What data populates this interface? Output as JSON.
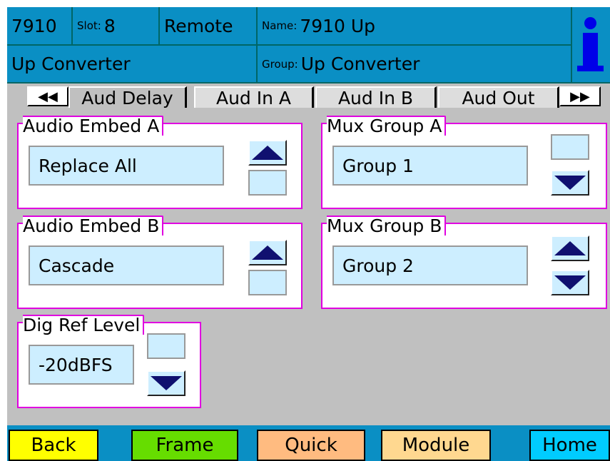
{
  "header": {
    "model": "7910",
    "slot_label": "Slot:",
    "slot_value": "8",
    "mode": "Remote",
    "name_label": "Name:",
    "name_value": "7910 Up",
    "module_type": "Up Converter",
    "group_label": "Group:",
    "group_value": "Up Converter",
    "info_icon": "info-icon"
  },
  "tabs": {
    "prev_icon": "double-left-arrow-icon",
    "next_icon": "double-right-arrow-icon",
    "items": [
      {
        "label": "Aud Delay"
      },
      {
        "label": "Aud In A"
      },
      {
        "label": "Aud In B"
      },
      {
        "label": "Aud Out"
      }
    ]
  },
  "controls": {
    "audio_embed_a": {
      "label": "Audio Embed A",
      "value": "Replace All"
    },
    "mux_group_a": {
      "label": "Mux Group A",
      "value": "Group 1"
    },
    "audio_embed_b": {
      "label": "Audio Embed B",
      "value": "Cascade"
    },
    "mux_group_b": {
      "label": "Mux Group B",
      "value": "Group 2"
    },
    "dig_ref_level": {
      "label": "Dig Ref Level",
      "value": "-20dBFS"
    }
  },
  "footer": {
    "back": {
      "label": "Back",
      "color": "#ffff00"
    },
    "frame": {
      "label": "Frame",
      "color": "#66dd00"
    },
    "quick": {
      "label": "Quick",
      "color": "#ffbb80"
    },
    "module": {
      "label": "Module",
      "color": "#ffd890"
    },
    "home": {
      "label": "Home",
      "color": "#00ccff"
    }
  },
  "colors": {
    "header_bg": "#0a8fc4",
    "group_border": "#e000e0",
    "field_bg": "#cdeeff",
    "arrow": "#101070"
  }
}
